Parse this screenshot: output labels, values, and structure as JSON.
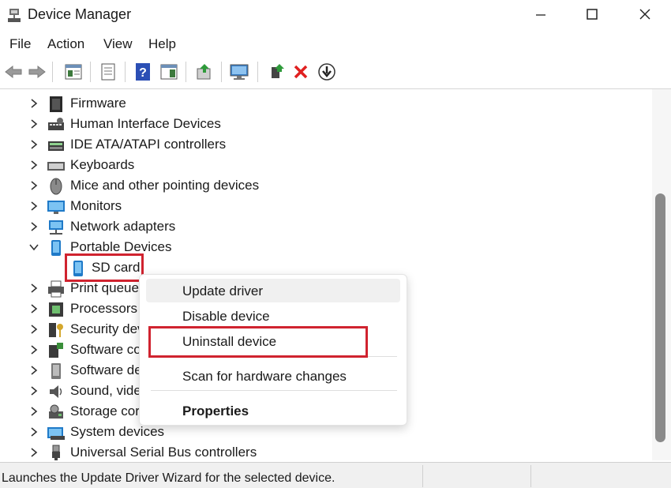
{
  "window": {
    "title": "Device Manager",
    "minimize": "—",
    "maximize": "☐",
    "close": "✕"
  },
  "menu": [
    "File",
    "Action",
    "View",
    "Help"
  ],
  "toolbar": [
    "back-arrow",
    "forward-arrow",
    "properties",
    "console-tree",
    "help",
    "action-pane",
    "update-driver",
    "scan-hardware",
    "enable-device",
    "uninstall",
    "download"
  ],
  "tree": [
    {
      "label": "Firmware",
      "icon": "firmware-icon",
      "expanded": false
    },
    {
      "label": "Human Interface Devices",
      "icon": "hid-icon",
      "expanded": false
    },
    {
      "label": "IDE ATA/ATAPI controllers",
      "icon": "ide-icon",
      "expanded": false
    },
    {
      "label": "Keyboards",
      "icon": "keyboard-icon",
      "expanded": false
    },
    {
      "label": "Mice and other pointing devices",
      "icon": "mouse-icon",
      "expanded": false
    },
    {
      "label": "Monitors",
      "icon": "monitor-icon",
      "expanded": false
    },
    {
      "label": "Network adapters",
      "icon": "network-icon",
      "expanded": false
    },
    {
      "label": "Portable Devices",
      "icon": "portable-device-icon",
      "expanded": true
    },
    {
      "label": "SD card",
      "icon": "sd-card-icon",
      "child": true,
      "selected": true
    },
    {
      "label": "Print queue",
      "icon": "printer-icon",
      "expanded": false
    },
    {
      "label": "Processors",
      "icon": "processor-icon",
      "expanded": false
    },
    {
      "label": "Security dev",
      "icon": "security-icon",
      "expanded": false
    },
    {
      "label": "Software co",
      "icon": "software-component-icon",
      "expanded": false
    },
    {
      "label": "Software de",
      "icon": "software-device-icon",
      "expanded": false
    },
    {
      "label": "Sound, vide",
      "icon": "sound-icon",
      "expanded": false
    },
    {
      "label": "Storage cor",
      "icon": "storage-icon",
      "expanded": false
    },
    {
      "label": "System devices",
      "icon": "system-icon",
      "expanded": false
    },
    {
      "label": "Universal Serial Bus controllers",
      "icon": "usb-icon",
      "expanded": false
    }
  ],
  "context_menu": {
    "update_driver": "Update driver",
    "disable_device": "Disable device",
    "uninstall_device": "Uninstall device",
    "scan_hardware": "Scan for hardware changes",
    "properties": "Properties"
  },
  "status": "Launches the Update Driver Wizard for the selected device.",
  "colors": {
    "highlight": "#d0232f",
    "icon_blue": "#1f7ac8",
    "red_x": "#e02020"
  }
}
